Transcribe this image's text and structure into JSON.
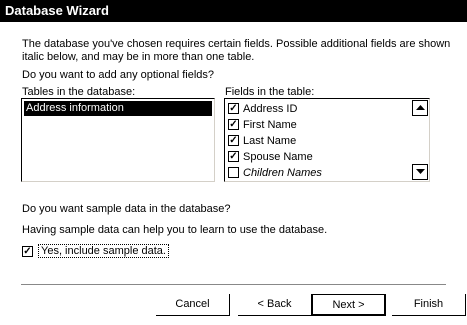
{
  "window": {
    "title": "Database Wizard"
  },
  "intro": {
    "text": "The database you've chosen requires certain fields. Possible additional fields are shown italic below, and may be in more than one table.",
    "question": "Do you want to add any optional fields?"
  },
  "tables": {
    "label": "Tables in the database:",
    "items": [
      {
        "label": "Address information",
        "selected": true
      }
    ]
  },
  "fields": {
    "label": "Fields in the table:",
    "items": [
      {
        "label": "Address ID",
        "checked": true,
        "italic": false
      },
      {
        "label": "First Name",
        "checked": true,
        "italic": false
      },
      {
        "label": "Last Name",
        "checked": true,
        "italic": false
      },
      {
        "label": "Spouse Name",
        "checked": true,
        "italic": false
      },
      {
        "label": "Children Names",
        "checked": false,
        "italic": true
      }
    ]
  },
  "sample": {
    "question": "Do you want sample data in the database?",
    "info": "Having sample data can help you to learn to use the database.",
    "checkbox_label": "Yes, include sample data.",
    "checked": true
  },
  "buttons": {
    "cancel": "Cancel",
    "back": "< Back",
    "next": "Next >",
    "finish": "Finish"
  }
}
